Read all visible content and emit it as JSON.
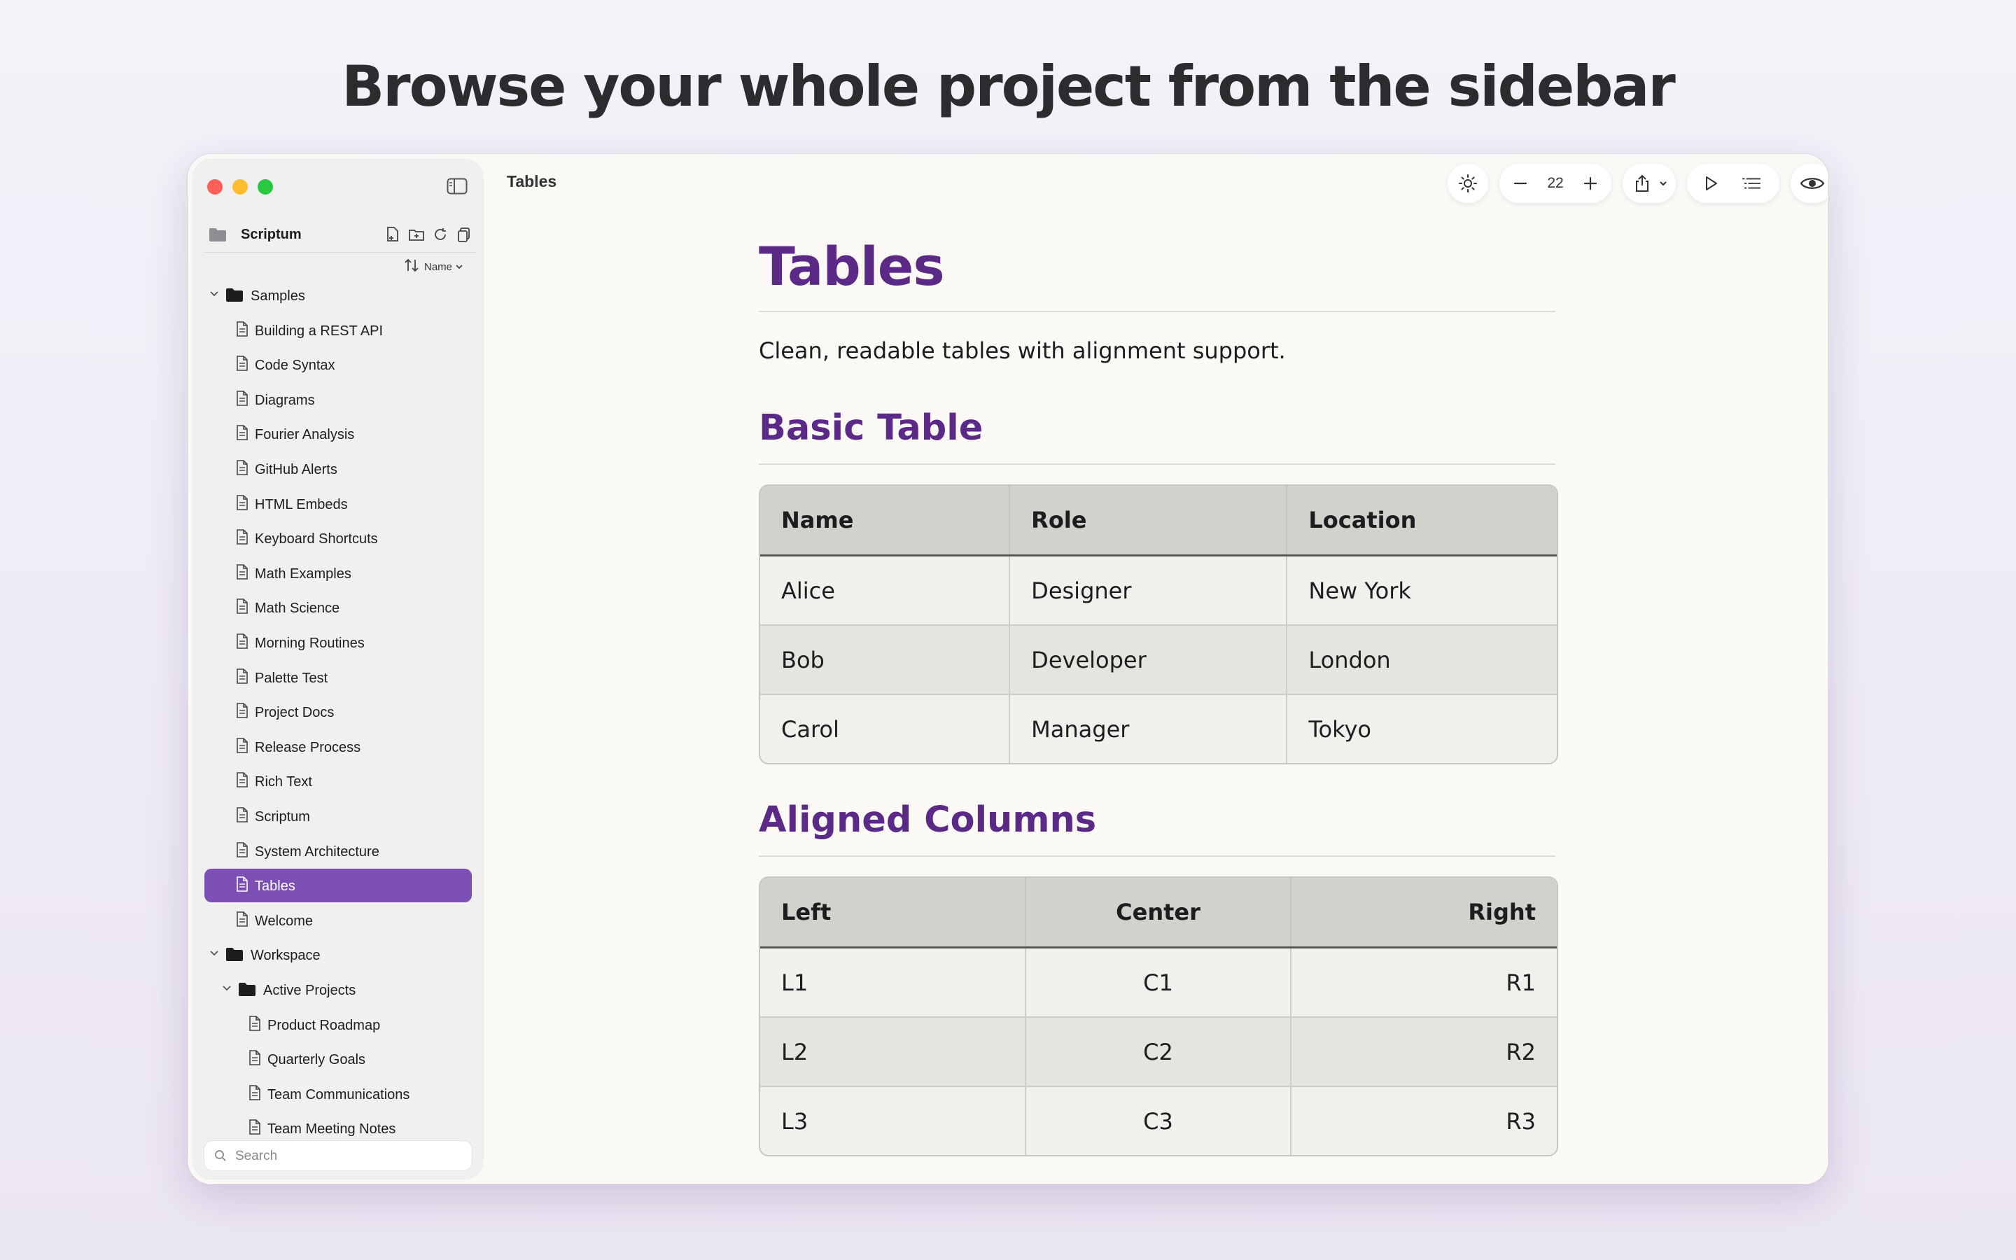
{
  "headline": "Browse your whole project from the sidebar",
  "sidebar": {
    "project_name": "Scriptum",
    "sort_label": "Name",
    "search_placeholder": "Search",
    "tree": [
      {
        "label": "Samples",
        "type": "folder",
        "depth": 0,
        "expanded": true
      },
      {
        "label": "Building a REST API",
        "type": "file",
        "depth": 1
      },
      {
        "label": "Code Syntax",
        "type": "file",
        "depth": 1
      },
      {
        "label": "Diagrams",
        "type": "file",
        "depth": 1
      },
      {
        "label": "Fourier Analysis",
        "type": "file",
        "depth": 1
      },
      {
        "label": "GitHub Alerts",
        "type": "file",
        "depth": 1
      },
      {
        "label": "HTML Embeds",
        "type": "file",
        "depth": 1
      },
      {
        "label": "Keyboard Shortcuts",
        "type": "file",
        "depth": 1
      },
      {
        "label": "Math Examples",
        "type": "file",
        "depth": 1
      },
      {
        "label": "Math Science",
        "type": "file",
        "depth": 1
      },
      {
        "label": "Morning Routines",
        "type": "file",
        "depth": 1
      },
      {
        "label": "Palette Test",
        "type": "file",
        "depth": 1
      },
      {
        "label": "Project Docs",
        "type": "file",
        "depth": 1
      },
      {
        "label": "Release Process",
        "type": "file",
        "depth": 1
      },
      {
        "label": "Rich Text",
        "type": "file",
        "depth": 1
      },
      {
        "label": "Scriptum",
        "type": "file",
        "depth": 1
      },
      {
        "label": "System Architecture",
        "type": "file",
        "depth": 1
      },
      {
        "label": "Tables",
        "type": "file",
        "depth": 1,
        "selected": true
      },
      {
        "label": "Welcome",
        "type": "file",
        "depth": 1
      },
      {
        "label": "Workspace",
        "type": "folder",
        "depth": 0,
        "expanded": true
      },
      {
        "label": "Active Projects",
        "type": "folder",
        "depth": 1,
        "expanded": true
      },
      {
        "label": "Product Roadmap",
        "type": "file",
        "depth": 2
      },
      {
        "label": "Quarterly Goals",
        "type": "file",
        "depth": 2
      },
      {
        "label": "Team Communications",
        "type": "file",
        "depth": 2
      },
      {
        "label": "Team Meeting Notes",
        "type": "file",
        "depth": 2
      }
    ]
  },
  "toolbar": {
    "document_title": "Tables",
    "font_size": "22",
    "icons": [
      "sun-icon",
      "minus-icon",
      "plus-icon",
      "share-icon",
      "play-icon",
      "outline-icon",
      "eye-icon"
    ]
  },
  "document": {
    "title": "Tables",
    "intro": "Clean, readable tables with alignment support.",
    "sections": [
      {
        "heading": "Basic Table",
        "columns": [
          {
            "label": "Name",
            "align": "left"
          },
          {
            "label": "Role",
            "align": "left"
          },
          {
            "label": "Location",
            "align": "left"
          }
        ],
        "rows": [
          [
            "Alice",
            "Designer",
            "New York"
          ],
          [
            "Bob",
            "Developer",
            "London"
          ],
          [
            "Carol",
            "Manager",
            "Tokyo"
          ]
        ]
      },
      {
        "heading": "Aligned Columns",
        "columns": [
          {
            "label": "Left",
            "align": "left"
          },
          {
            "label": "Center",
            "align": "center"
          },
          {
            "label": "Right",
            "align": "right"
          }
        ],
        "rows": [
          [
            "L1",
            "C1",
            "R1"
          ],
          [
            "L2",
            "C2",
            "R2"
          ],
          [
            "L3",
            "C3",
            "R3"
          ]
        ]
      }
    ]
  },
  "colors": {
    "accent": "#7b4fb3",
    "heading": "#5b2a86",
    "background": "#f4f2f9"
  }
}
